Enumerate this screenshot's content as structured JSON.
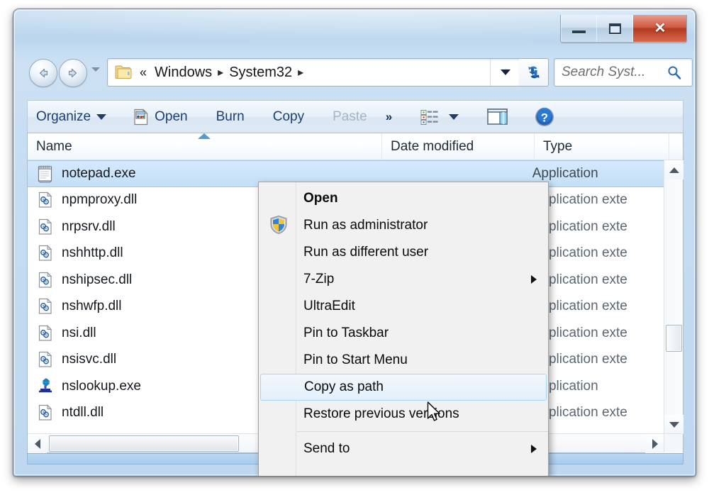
{
  "window": {
    "title": "",
    "caption_buttons": [
      {
        "name": "minimize",
        "glyph": "minimize-icon"
      },
      {
        "name": "maximize",
        "glyph": "maximize-icon"
      },
      {
        "name": "close",
        "glyph": "close-icon",
        "label": "✕",
        "color": "#b33a22"
      }
    ]
  },
  "nav": {
    "back_tooltip": "Back",
    "forward_tooltip": "Forward",
    "recent_pages_icon": "chevron-down-icon"
  },
  "address": {
    "folder_icon": "folder-icon",
    "overflow_chevrons": "«",
    "crumbs": [
      "Windows",
      "System32"
    ],
    "separator": "▸",
    "dropdown_icon": "chevron-down-icon",
    "refresh_icon": "refresh-icon"
  },
  "search": {
    "placeholder": "Search Syst...",
    "icon": "search-icon"
  },
  "toolbar": {
    "organize_label": "Organize",
    "open_label": "Open",
    "open_icon": "open-file-icon",
    "burn_label": "Burn",
    "copy_label": "Copy",
    "paste_label": "Paste",
    "paste_disabled": true,
    "overflow_label": "»",
    "views_icon": "view-list-icon",
    "views_caret_icon": "chevron-down-icon",
    "preview_pane_icon": "preview-pane-icon",
    "help_icon": "help-icon"
  },
  "columns": {
    "name": "Name",
    "date_modified": "Date modified",
    "type": "Type",
    "sort_indicator": "ascending"
  },
  "files": [
    {
      "name": "notepad.exe",
      "date": "",
      "type": "Application",
      "icon": "notepad-icon",
      "selected": true
    },
    {
      "name": "npmproxy.dll",
      "date": "",
      "type": "Application exte",
      "icon": "dll-icon",
      "selected": false
    },
    {
      "name": "nrpsrv.dll",
      "date": "",
      "type": "Application exte",
      "icon": "dll-icon",
      "selected": false
    },
    {
      "name": "nshhttp.dll",
      "date": "",
      "type": "Application exte",
      "icon": "dll-icon",
      "selected": false
    },
    {
      "name": "nshipsec.dll",
      "date": "",
      "type": "Application exte",
      "icon": "dll-icon",
      "selected": false
    },
    {
      "name": "nshwfp.dll",
      "date": "",
      "type": "Application exte",
      "icon": "dll-icon",
      "selected": false
    },
    {
      "name": "nsi.dll",
      "date": "",
      "type": "Application exte",
      "icon": "dll-icon",
      "selected": false
    },
    {
      "name": "nsisvc.dll",
      "date": "",
      "type": "Application exte",
      "icon": "dll-icon",
      "selected": false
    },
    {
      "name": "nslookup.exe",
      "date": "",
      "type": "Application",
      "icon": "nslookup-icon",
      "selected": false
    },
    {
      "name": "ntdll.dll",
      "date": "",
      "type": "Application exte",
      "icon": "dll-icon",
      "selected": false
    }
  ],
  "context_menu": {
    "items": [
      {
        "label": "Open",
        "bold": true,
        "icon": null,
        "submenu": false,
        "hover": false
      },
      {
        "label": "Run as administrator",
        "bold": false,
        "icon": "shield-icon",
        "submenu": false,
        "hover": false
      },
      {
        "label": "Run as different user",
        "bold": false,
        "icon": null,
        "submenu": false,
        "hover": false
      },
      {
        "label": "7-Zip",
        "bold": false,
        "icon": null,
        "submenu": true,
        "hover": false
      },
      {
        "label": "UltraEdit",
        "bold": false,
        "icon": null,
        "submenu": false,
        "hover": false
      },
      {
        "label": "Pin to Taskbar",
        "bold": false,
        "icon": null,
        "submenu": false,
        "hover": false
      },
      {
        "label": "Pin to Start Menu",
        "bold": false,
        "icon": null,
        "submenu": false,
        "hover": false
      },
      {
        "label": "Copy as path",
        "bold": false,
        "icon": null,
        "submenu": false,
        "hover": true
      },
      {
        "label": "Restore previous versions",
        "bold": false,
        "icon": null,
        "submenu": false,
        "hover": false
      },
      {
        "label": "Send to",
        "bold": false,
        "icon": null,
        "submenu": true,
        "hover": false
      }
    ],
    "separator_after_index": 8
  },
  "scrollbars": {
    "vertical_up_icon": "scroll-up-icon",
    "vertical_down_icon": "scroll-down-icon",
    "horizontal_left_icon": "scroll-left-icon",
    "horizontal_right_icon": "scroll-right-icon"
  },
  "colors": {
    "aero_frame": "#c5dcf1",
    "selection": "#c4dff7",
    "close_button": "#b33a22",
    "toolbar_text": "#1c3f6e",
    "sort_arrow": "#4f9cd4",
    "status_strip": "#a9cdee"
  }
}
